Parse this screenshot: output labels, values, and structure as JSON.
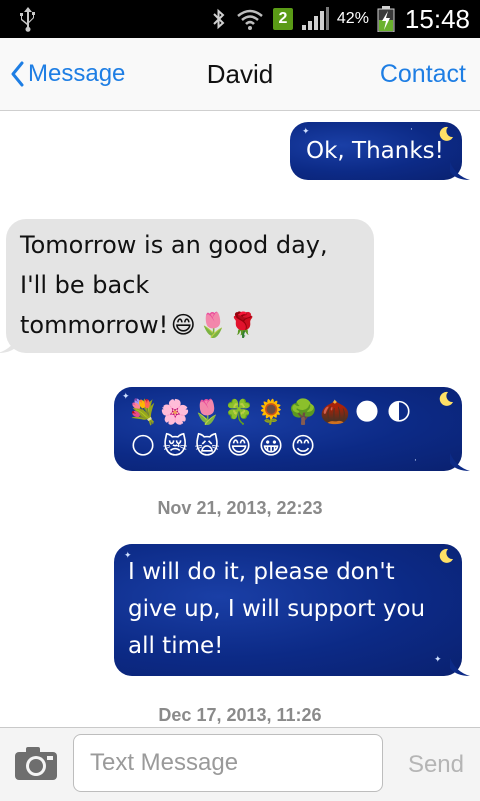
{
  "status_bar": {
    "notification_badge": "2",
    "battery_percent": "42%",
    "time": "15:48",
    "icons": [
      "usb-icon",
      "bluetooth-icon",
      "wifi-icon",
      "signal-icon",
      "battery-charging-icon"
    ]
  },
  "nav": {
    "back_label": "Message",
    "title": "David",
    "right_label": "Contact",
    "accent_color": "#1e7ee4"
  },
  "messages": [
    {
      "direction": "sent",
      "text": "Ok, Thanks!"
    },
    {
      "direction": "received",
      "lines": [
        "Tomorrow is an good day,",
        "I'll be back",
        "tommorrow!"
      ],
      "emojis": [
        "😄",
        "🌷",
        "🌹"
      ]
    },
    {
      "direction": "sent",
      "emoji_rows": [
        [
          "💐",
          "🌸",
          "🌷",
          "🍀",
          "🌻",
          "🌳",
          "🌰",
          "🌑",
          "🌓"
        ],
        [
          "🌕",
          "😿",
          "🙀",
          "😄",
          "😀",
          "😊"
        ]
      ]
    },
    {
      "timestamp": "Nov 21, 2013, 22:23"
    },
    {
      "direction": "sent",
      "lines": [
        "I will do it, please don't",
        "give up, I will support you",
        "all time!"
      ]
    },
    {
      "timestamp": "Dec 17, 2013, 11:26"
    }
  ],
  "composer": {
    "placeholder": "Text Message",
    "value": "",
    "send_label": "Send"
  },
  "colors": {
    "sent_bubble": "#0c2a86",
    "received_bubble": "#e4e4e4",
    "send_disabled": "#b5b5b5"
  }
}
